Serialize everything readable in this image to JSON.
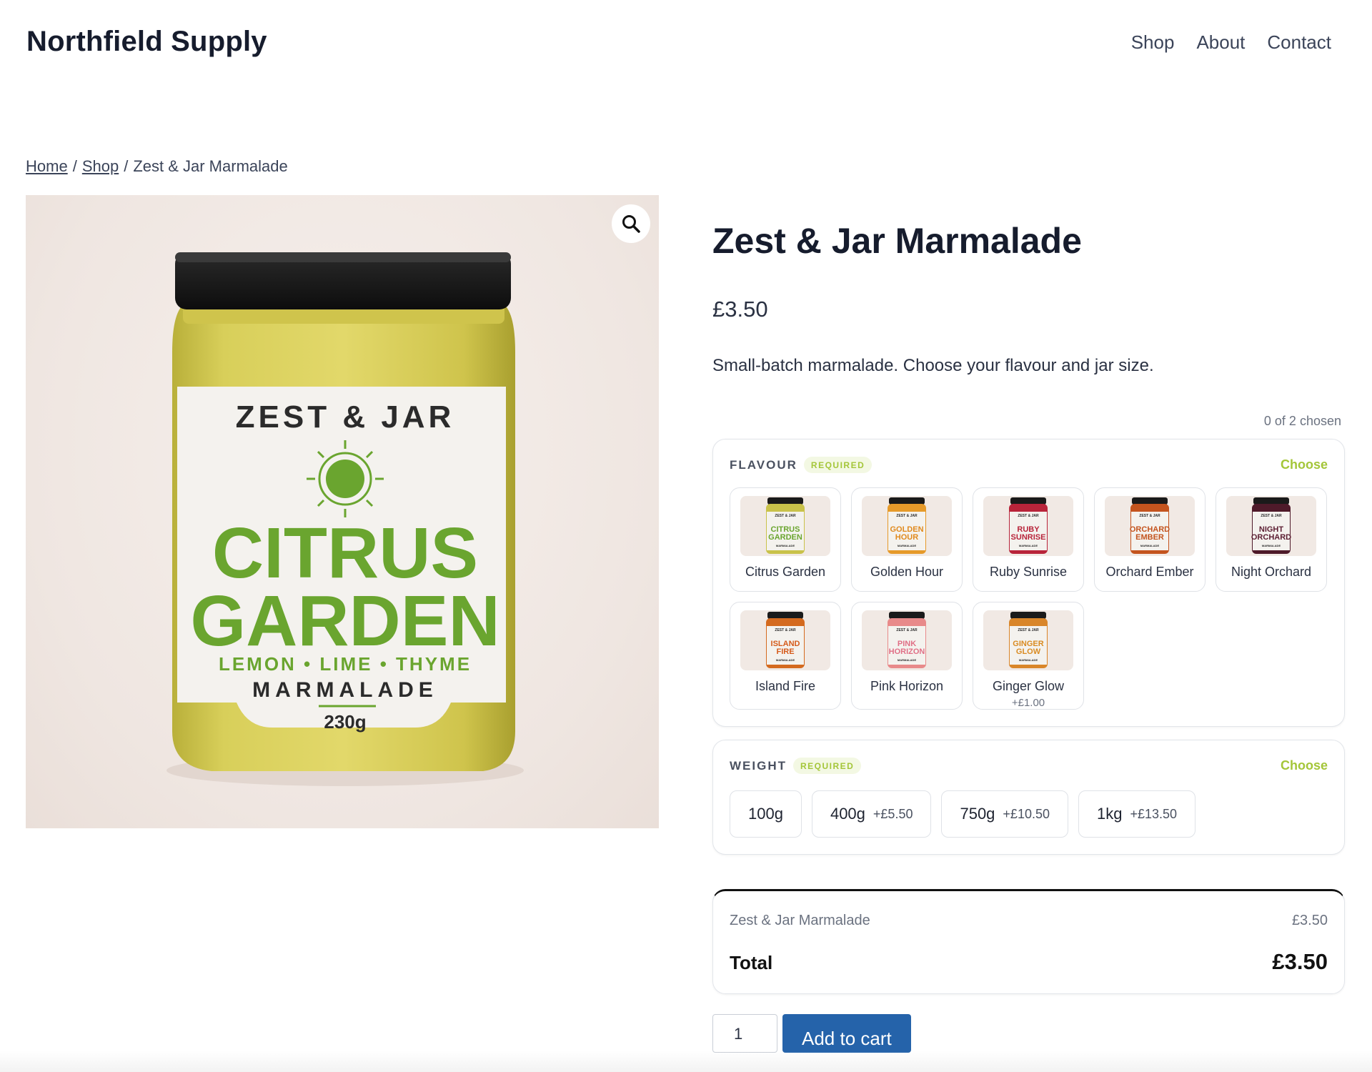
{
  "site": {
    "title": "Northfield Supply"
  },
  "nav": {
    "items": [
      {
        "label": "Shop"
      },
      {
        "label": "About"
      },
      {
        "label": "Contact"
      }
    ]
  },
  "breadcrumb": {
    "home": "Home",
    "shop": "Shop",
    "sep": "/",
    "current": "Zest & Jar Marmalade"
  },
  "gallery": {
    "zoom_icon": "magnifier-icon",
    "label": {
      "brand": "ZEST & JAR",
      "line1": "CITRUS",
      "line2": "GARDEN",
      "flavours": "LEMON • LIME • THYME",
      "type": "MARMALADE",
      "weight": "230g"
    }
  },
  "product": {
    "title": "Zest & Jar Marmalade",
    "price": "£3.50",
    "description": "Small-batch marmalade. Choose your flavour and jar size.",
    "chosen_count": "0 of 2 chosen"
  },
  "flavour": {
    "label": "FLAVOUR",
    "required": "REQUIRED",
    "choose": "Choose",
    "options": [
      {
        "name": "Citrus Garden",
        "price": "",
        "thumb_lines": [
          "CITRUS",
          "GARDEN"
        ],
        "fill": "#c9c24a",
        "text_color": "#6aa52f"
      },
      {
        "name": "Golden Hour",
        "price": "",
        "thumb_lines": [
          "GOLDEN",
          "HOUR"
        ],
        "fill": "#e69a2a",
        "text_color": "#e08a1e"
      },
      {
        "name": "Ruby Sunrise",
        "price": "",
        "thumb_lines": [
          "RUBY",
          "SUNRISE"
        ],
        "fill": "#b8243a",
        "text_color": "#b8243a"
      },
      {
        "name": "Orchard Ember",
        "price": "",
        "thumb_lines": [
          "ORCHARD",
          "EMBER"
        ],
        "fill": "#c4541e",
        "text_color": "#c4541e"
      },
      {
        "name": "Night Orchard",
        "price": "",
        "thumb_lines": [
          "NIGHT",
          "ORCHARD"
        ],
        "fill": "#4e1a2a",
        "text_color": "#5c1f33"
      },
      {
        "name": "Island Fire",
        "price": "",
        "thumb_lines": [
          "ISLAND",
          "FIRE"
        ],
        "fill": "#d46a1f",
        "text_color": "#d55a1a"
      },
      {
        "name": "Pink Horizon",
        "price": "",
        "thumb_lines": [
          "PINK",
          "HORIZON"
        ],
        "fill": "#e88a8a",
        "text_color": "#e06f86"
      },
      {
        "name": "Ginger Glow",
        "price": "+£1.00",
        "thumb_lines": [
          "GINGER",
          "GLOW"
        ],
        "fill": "#d9862a",
        "text_color": "#d98b22"
      }
    ],
    "thumb_brand": "ZEST & JAR",
    "thumb_type": "MARMALADE"
  },
  "weight": {
    "label": "WEIGHT",
    "required": "REQUIRED",
    "choose": "Choose",
    "options": [
      {
        "label": "100g",
        "add": ""
      },
      {
        "label": "400g",
        "add": "+£5.50"
      },
      {
        "label": "750g",
        "add": "+£10.50"
      },
      {
        "label": "1kg",
        "add": "+£13.50"
      }
    ]
  },
  "totals": {
    "line_name": "Zest & Jar Marmalade",
    "line_price": "£3.50",
    "total_label": "Total",
    "total_value": "£3.50"
  },
  "cart": {
    "qty": "1",
    "button": "Add to cart"
  },
  "colors": {
    "accent": "#a4c639",
    "button": "#2563aa",
    "label_green": "#6aa52f"
  }
}
